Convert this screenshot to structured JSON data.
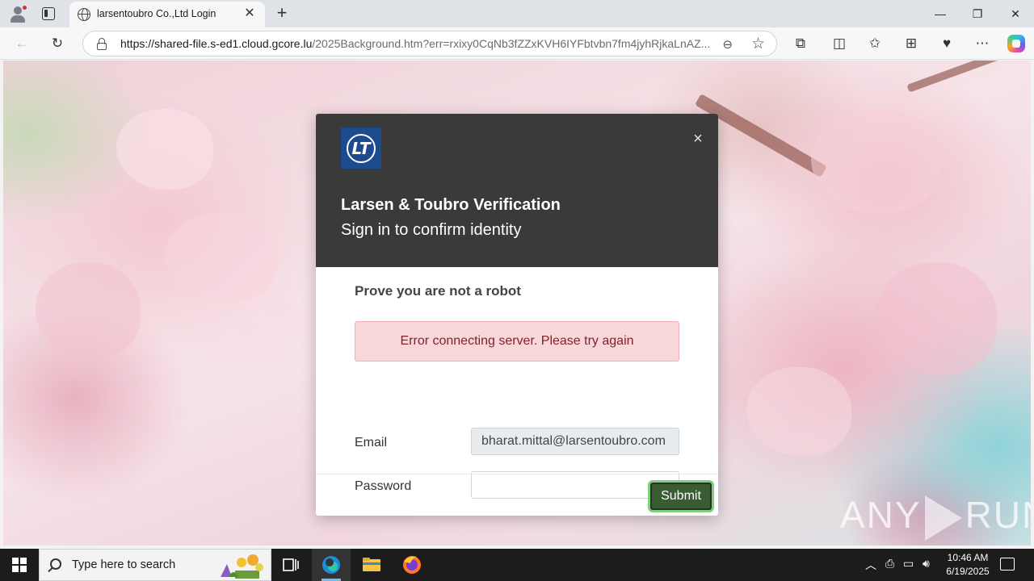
{
  "browser": {
    "tab_title": "larsentoubro Co.,Ltd Login",
    "url_host": "https://shared-file.s-ed1.cloud.gcore.lu",
    "url_rest": "/2025Background.htm?err=rxixy0CqNb3fZZxKVH6IYFbtvbn7fm4jyhRjkaLnAZ..."
  },
  "modal": {
    "title": "Larsen & Toubro Verification",
    "subtitle": "Sign in to confirm identity",
    "close_glyph": "×",
    "section_title": "Prove you are not a robot",
    "error": "Error connecting server. Please try again",
    "email_label": "Email",
    "email_value": "bharat.mittal@larsentoubro.com",
    "password_label": "Password",
    "password_value": "",
    "submit_label": "Submit"
  },
  "watermark": {
    "left": "ANY",
    "right": "RUN"
  },
  "taskbar": {
    "search_placeholder": "Type here to search",
    "time": "10:46 AM",
    "date": "6/19/2025"
  },
  "icons": {
    "browser": [
      "profile-icon",
      "tab-actions-icon",
      "globe-icon",
      "close-icon",
      "plus-icon",
      "back-icon",
      "refresh-icon",
      "lock-icon",
      "read-aloud-icon",
      "star-icon",
      "extensions-icon",
      "split-screen-icon",
      "favorites-icon",
      "collections-icon",
      "performance-icon",
      "more-icon",
      "copilot-icon"
    ],
    "taskbar": [
      "windows-start-icon",
      "search-icon",
      "task-view-icon",
      "edge-icon",
      "file-explorer-icon",
      "firefox-icon",
      "chevron-up-icon",
      "network-icon",
      "volume-icon",
      "notification-icon"
    ]
  },
  "colors": {
    "modal_header": "#3a3a3a",
    "brand_blue": "#1d4b8f",
    "alert_bg": "#f8d7da",
    "alert_text": "#842029",
    "submit_bg": "#395d33",
    "submit_focus": "#7fd07a"
  }
}
